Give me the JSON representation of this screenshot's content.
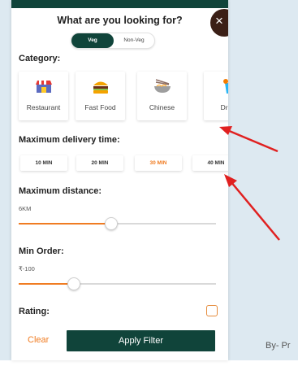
{
  "header": {
    "title": "What are you looking for?",
    "close_icon": "×"
  },
  "diet_toggle": {
    "options": [
      "Veg",
      "Non-Veg"
    ],
    "selected": "Veg"
  },
  "category": {
    "label": "Category:",
    "items": [
      {
        "label": "Restaurant",
        "icon": "restaurant-icon"
      },
      {
        "label": "Fast Food",
        "icon": "burger-icon"
      },
      {
        "label": "Chinese",
        "icon": "noodles-icon"
      },
      {
        "label": "Drink",
        "icon": "drink-icon"
      }
    ]
  },
  "delivery_time": {
    "label": "Maximum delivery time:",
    "options": [
      "10 MIN",
      "20 MIN",
      "30 MIN",
      "40 MIN"
    ],
    "selected": "30 MIN"
  },
  "distance": {
    "label": "Maximum distance:",
    "value": "6KM",
    "level": 0.47
  },
  "min_order": {
    "label": "Min Order:",
    "value": "₹-100",
    "level": 0.28
  },
  "rating": {
    "label": "Rating:",
    "checked": false
  },
  "actions": {
    "clear": "Clear",
    "apply": "Apply Filter"
  },
  "credit": "By- Pr",
  "colors": {
    "primary": "#10443a",
    "accent": "#f07c22",
    "background": "#dde9f1",
    "annotation": "#e02020"
  }
}
